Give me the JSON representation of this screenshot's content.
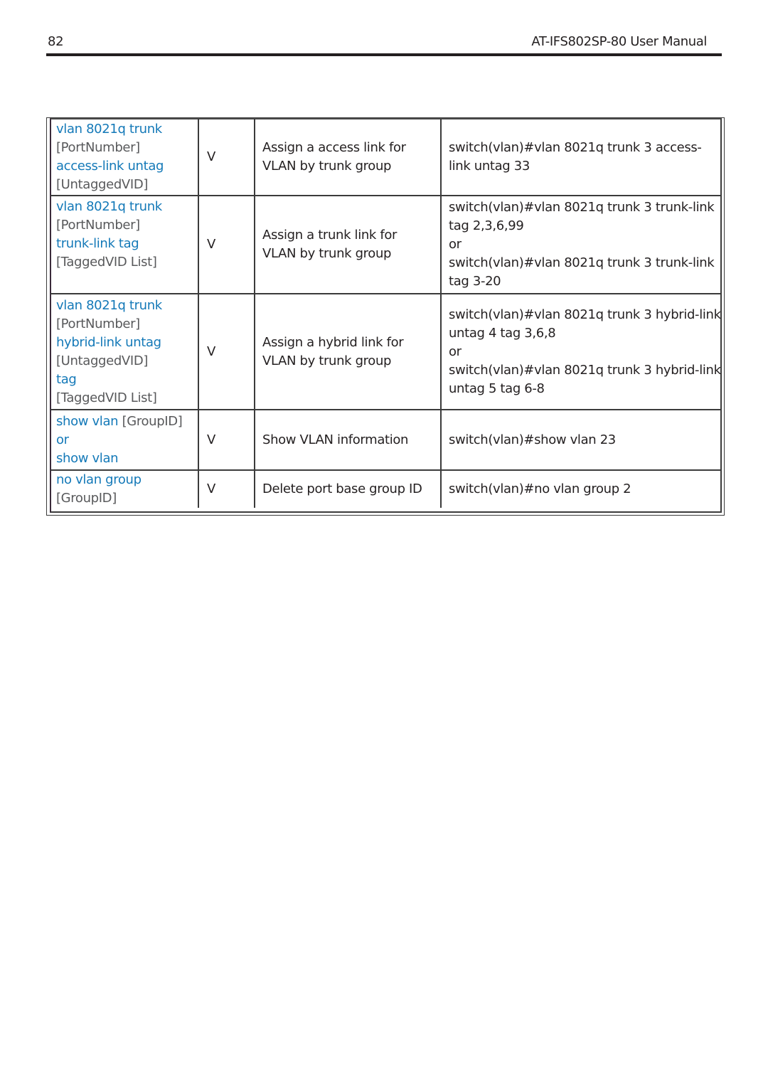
{
  "header": {
    "page_number": "82",
    "doc_title": "AT-IFS802SP-80 User Manual"
  },
  "colors": {
    "command_keyword": "#1479b8",
    "command_argument": "#58595b",
    "body_text": "#231f20",
    "rule": "#231f20"
  },
  "table": {
    "rows": [
      {
        "command": [
          {
            "kw": "vlan 8021q trunk"
          },
          {
            "arg": "[PortNumber]"
          },
          {
            "kw": "access-link untag"
          },
          {
            "arg": "[UntaggedVID]"
          }
        ],
        "level": "V",
        "description": [
          "Assign a access link for",
          "VLAN by trunk group"
        ],
        "example": [
          "switch(vlan)#vlan 8021q trunk 3 access-",
          "link untag 33"
        ]
      },
      {
        "command": [
          {
            "kw": "vlan 8021q trunk"
          },
          {
            "arg": "[PortNumber]"
          },
          {
            "kw": "trunk-link tag"
          },
          {
            "arg": "[TaggedVID List]"
          }
        ],
        "level": "V",
        "description": [
          "Assign a trunk link for",
          "VLAN by trunk group"
        ],
        "example": [
          "switch(vlan)#vlan 8021q trunk 3 trunk-link",
          "tag 2,3,6,99",
          "or",
          "switch(vlan)#vlan 8021q trunk 3 trunk-link",
          "tag 3-20"
        ]
      },
      {
        "command": [
          {
            "kw": "vlan 8021q trunk"
          },
          {
            "arg": "[PortNumber]"
          },
          {
            "kw": "hybrid-link untag"
          },
          {
            "arg": "[UntaggedVID]"
          },
          {
            "kw": "tag"
          },
          {
            "arg": "[TaggedVID List]"
          }
        ],
        "level": "V",
        "description": [
          "Assign a hybrid link for",
          "VLAN by trunk group"
        ],
        "example": [
          "switch(vlan)#vlan 8021q trunk 3 hybrid-link",
          "untag 4 tag 3,6,8",
          "or",
          "switch(vlan)#vlan 8021q trunk 3 hybrid-link",
          "untag 5 tag 6-8"
        ]
      },
      {
        "command": [
          {
            "kw": "show vlan",
            "arg": "[GroupID]"
          },
          {
            "kw": "or"
          },
          {
            "kw": "show vlan"
          }
        ],
        "level": "V",
        "description": [
          "Show VLAN information"
        ],
        "example": [
          "switch(vlan)#show vlan 23"
        ]
      },
      {
        "command": [
          {
            "kw": "no vlan group"
          },
          {
            "arg": "[GroupID]"
          }
        ],
        "level": "V",
        "description": [
          "Delete port base group ID"
        ],
        "example": [
          "switch(vlan)#no vlan group 2"
        ]
      }
    ]
  }
}
